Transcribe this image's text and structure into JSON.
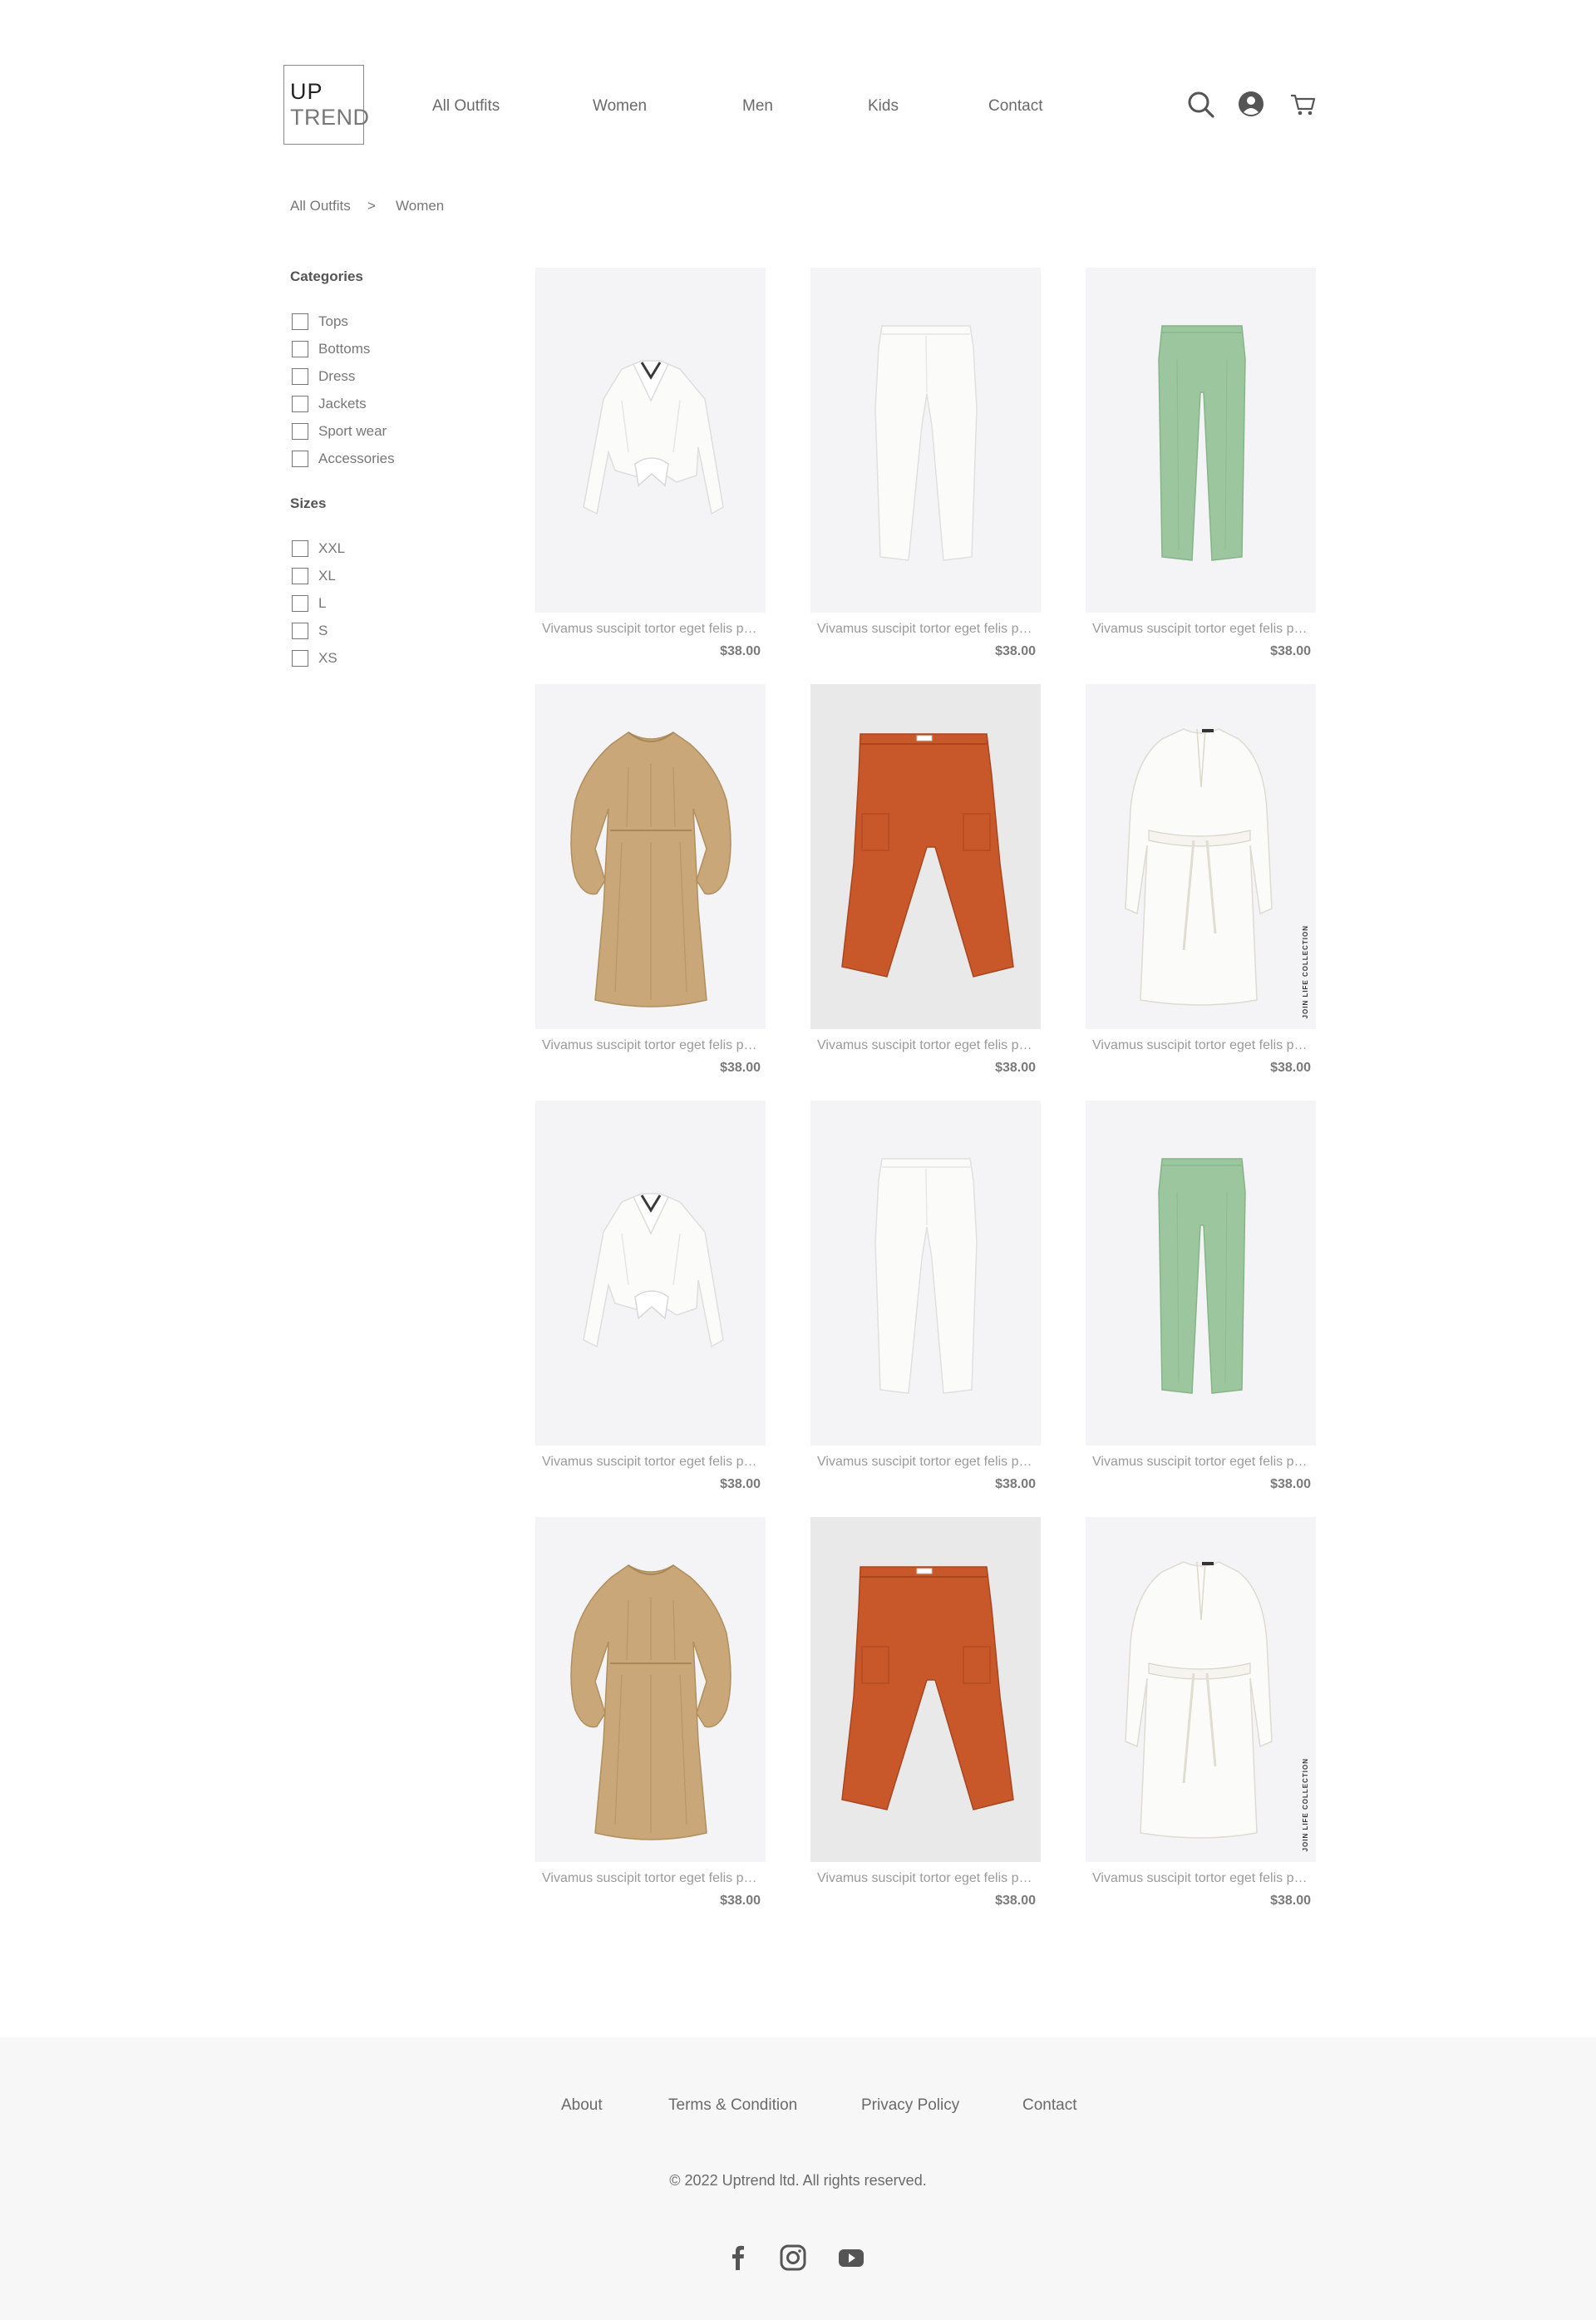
{
  "logo": {
    "line1": "UP",
    "line2": "TREND"
  },
  "nav": {
    "items": [
      "All Outfits",
      "Women",
      "Men",
      "Kids",
      "Contact"
    ]
  },
  "header_icons": [
    "search-icon",
    "user-icon",
    "cart-icon"
  ],
  "breadcrumb": {
    "items": [
      "All Outfits",
      "Women"
    ],
    "separator": ">"
  },
  "sidebar": {
    "categories_title": "Categories",
    "categories": [
      "Tops",
      "Bottoms",
      "Dress",
      "Jackets",
      "Sport wear",
      "Accessories"
    ],
    "sizes_title": "Sizes",
    "sizes": [
      "XXL",
      "XL",
      "L",
      "S",
      "XS"
    ]
  },
  "products": [
    {
      "name": "Vivamus suscipit tortor eget felis porttitor volutpat",
      "price": "$38.00",
      "image": "white-blouse"
    },
    {
      "name": "Vivamus suscipit tortor eget felis porttitor volutpat",
      "price": "$38.00",
      "image": "white-pants"
    },
    {
      "name": "Vivamus suscipit tortor eget felis porttitor volutpat",
      "price": "$38.00",
      "image": "green-pants"
    },
    {
      "name": "Vivamus suscipit tortor eget felis porttitor volutpat",
      "price": "$38.00",
      "image": "beige-dress"
    },
    {
      "name": "Vivamus suscipit tortor eget felis porttitor volutpat",
      "price": "$38.00",
      "image": "orange-pants"
    },
    {
      "name": "Vivamus suscipit tortor eget felis porttitor volutpat",
      "price": "$38.00",
      "image": "white-dress",
      "tag": "JOIN LIFE COLLECTION"
    },
    {
      "name": "Vivamus suscipit tortor eget felis porttitor volutpat",
      "price": "$38.00",
      "image": "white-blouse"
    },
    {
      "name": "Vivamus suscipit tortor eget felis porttitor volutpat",
      "price": "$38.00",
      "image": "white-pants"
    },
    {
      "name": "Vivamus suscipit tortor eget felis porttitor volutpat",
      "price": "$38.00",
      "image": "green-pants"
    },
    {
      "name": "Vivamus suscipit tortor eget felis porttitor volutpat",
      "price": "$38.00",
      "image": "beige-dress"
    },
    {
      "name": "Vivamus suscipit tortor eget felis porttitor volutpat",
      "price": "$38.00",
      "image": "orange-pants"
    },
    {
      "name": "Vivamus suscipit tortor eget felis porttitor volutpat",
      "price": "$38.00",
      "image": "white-dress",
      "tag": "JOIN LIFE COLLECTION"
    }
  ],
  "footer": {
    "links": [
      "About",
      "Terms & Condition",
      "Privacy Policy",
      "Contact"
    ],
    "copyright": "© 2022 Uptrend ltd. All rights reserved.",
    "social": [
      "facebook-icon",
      "instagram-icon",
      "youtube-icon"
    ]
  },
  "colors": {
    "green_pants": "#9cc79e",
    "orange_pants": "#c8582a",
    "beige_dress": "#c9a778",
    "white_garment": "#fbfbf9"
  }
}
